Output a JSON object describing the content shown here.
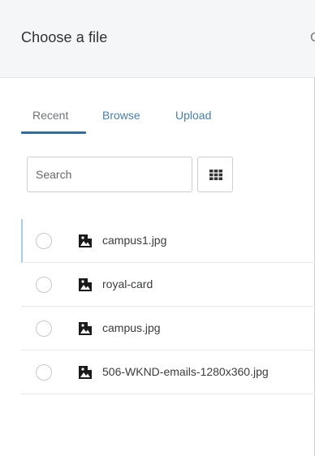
{
  "dialog": {
    "title": "Choose a file",
    "cut_glyph": "C"
  },
  "tabs": [
    {
      "label": "Recent",
      "active": true
    },
    {
      "label": "Browse",
      "active": false
    },
    {
      "label": "Upload",
      "active": false
    }
  ],
  "search": {
    "placeholder": "Search",
    "value": ""
  },
  "view_toggle": {
    "icon": "grid-view-icon"
  },
  "files": [
    {
      "name": "campus1.jpg",
      "icon": "image-file-icon",
      "selected": false
    },
    {
      "name": "royal-card",
      "icon": "image-file-icon",
      "selected": false
    },
    {
      "name": "campus.jpg",
      "icon": "image-file-icon",
      "selected": false
    },
    {
      "name": "506-WKND-emails-1280x360.jpg",
      "icon": "image-file-icon",
      "selected": false
    }
  ],
  "colors": {
    "accent": "#3a6b8e",
    "link": "#4a7ea6",
    "header_bg": "#f5f6f7",
    "focus_border": "#a8cde8"
  }
}
